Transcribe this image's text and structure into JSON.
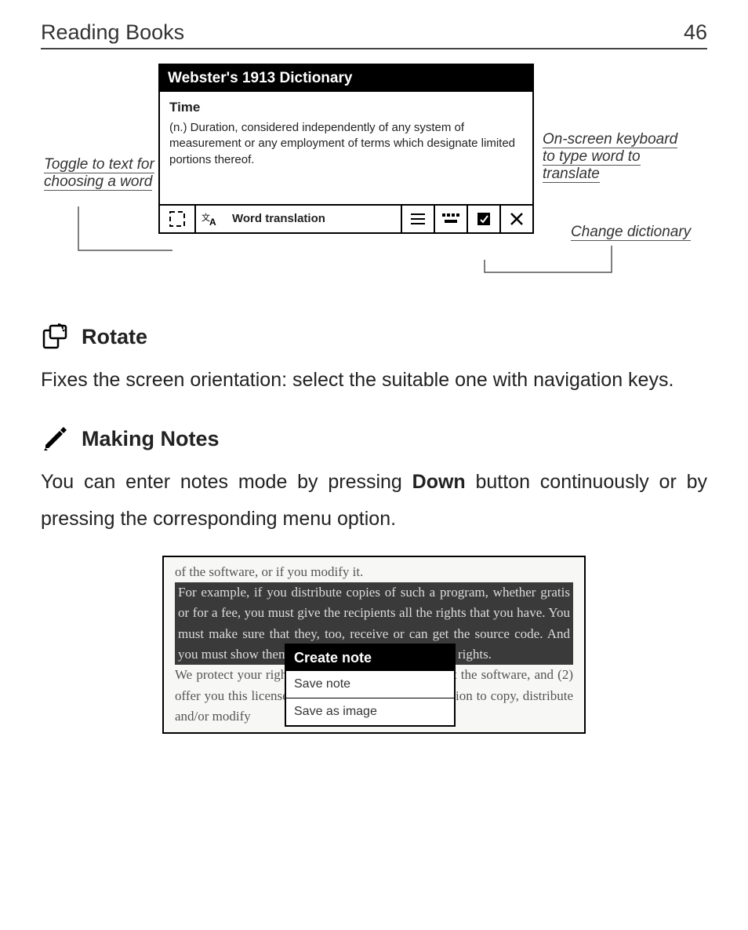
{
  "header": {
    "title": "Reading Books",
    "page": "46"
  },
  "dictionary": {
    "title": "Webster's 1913 Dictionary",
    "word": "Time",
    "definition": "(n.) Duration, considered independently of any system of measurement or any employment of terms which designate limited portions thereof.",
    "toolbar_label": "Word translation"
  },
  "callouts": {
    "toggle_text": "Toggle to text for choosing a word",
    "keyboard": "On-screen keyboard to type word to translate",
    "change_dict": "Change dictionary"
  },
  "rotate": {
    "heading": "Rotate",
    "body": "Fixes the screen orientation: select the suitable one with navigation keys."
  },
  "notes": {
    "heading": "Making Notes",
    "body_pre": "You can enter notes mode by pressing ",
    "body_key": "Down",
    "body_post": " button continuously or by pressing the corresponding menu option."
  },
  "notes_shot": {
    "line1": "of the software, or if you modify it.",
    "sel": "    For example, if you distribute copies of such a program, whether gratis or for a fee, you must give the recipients all the rights that you have. You must make sure that they, too, receive or can get the source code. And you must show them these terms so they know their rights.",
    "line2": "    We protect your rights with two steps: (1) copyright the software, and (2) offer you this license which gives you legal permission to copy, distribute and/or modify",
    "popup_title": "Create note",
    "popup_item1": "Save note",
    "popup_item2": "Save as image"
  }
}
